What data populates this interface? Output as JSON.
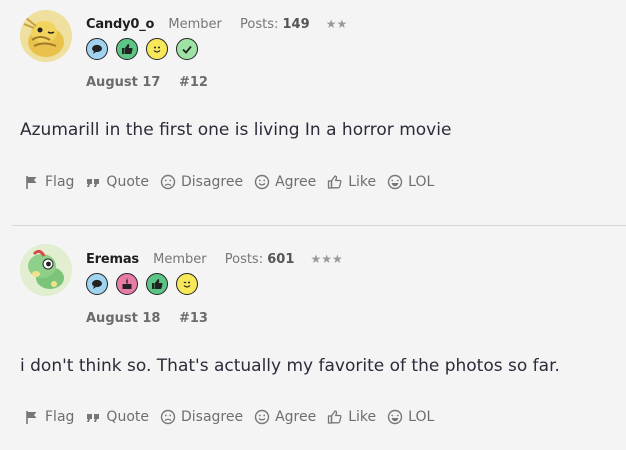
{
  "posts": [
    {
      "username": "Candy0_o",
      "role": "Member",
      "posts_label": "Posts:",
      "posts_count": "149",
      "stars": "★★",
      "date": "August 17",
      "number": "#12",
      "body": "Azumarill in the first one is living In a horror movie",
      "badges": [
        "speech-bubble",
        "thumbs-up",
        "smiley",
        "checkmark"
      ]
    },
    {
      "username": "Eremas",
      "role": "Member",
      "posts_label": "Posts:",
      "posts_count": "601",
      "stars": "★★★",
      "date": "August 18",
      "number": "#13",
      "body": "i don't think so. That's actually my favorite of the photos so far.",
      "badges": [
        "speech-bubble",
        "cake",
        "thumbs-up",
        "wink"
      ]
    }
  ],
  "actions": {
    "flag": "Flag",
    "quote": "Quote",
    "disagree": "Disagree",
    "agree": "Agree",
    "like": "Like",
    "lol": "LOL"
  },
  "colors": {
    "badge_blue": "#9fd3f0",
    "badge_green": "#5cc585",
    "badge_yellow": "#f7e85a",
    "badge_pink": "#e77da6",
    "badge_light_green": "#9ee3a5"
  }
}
